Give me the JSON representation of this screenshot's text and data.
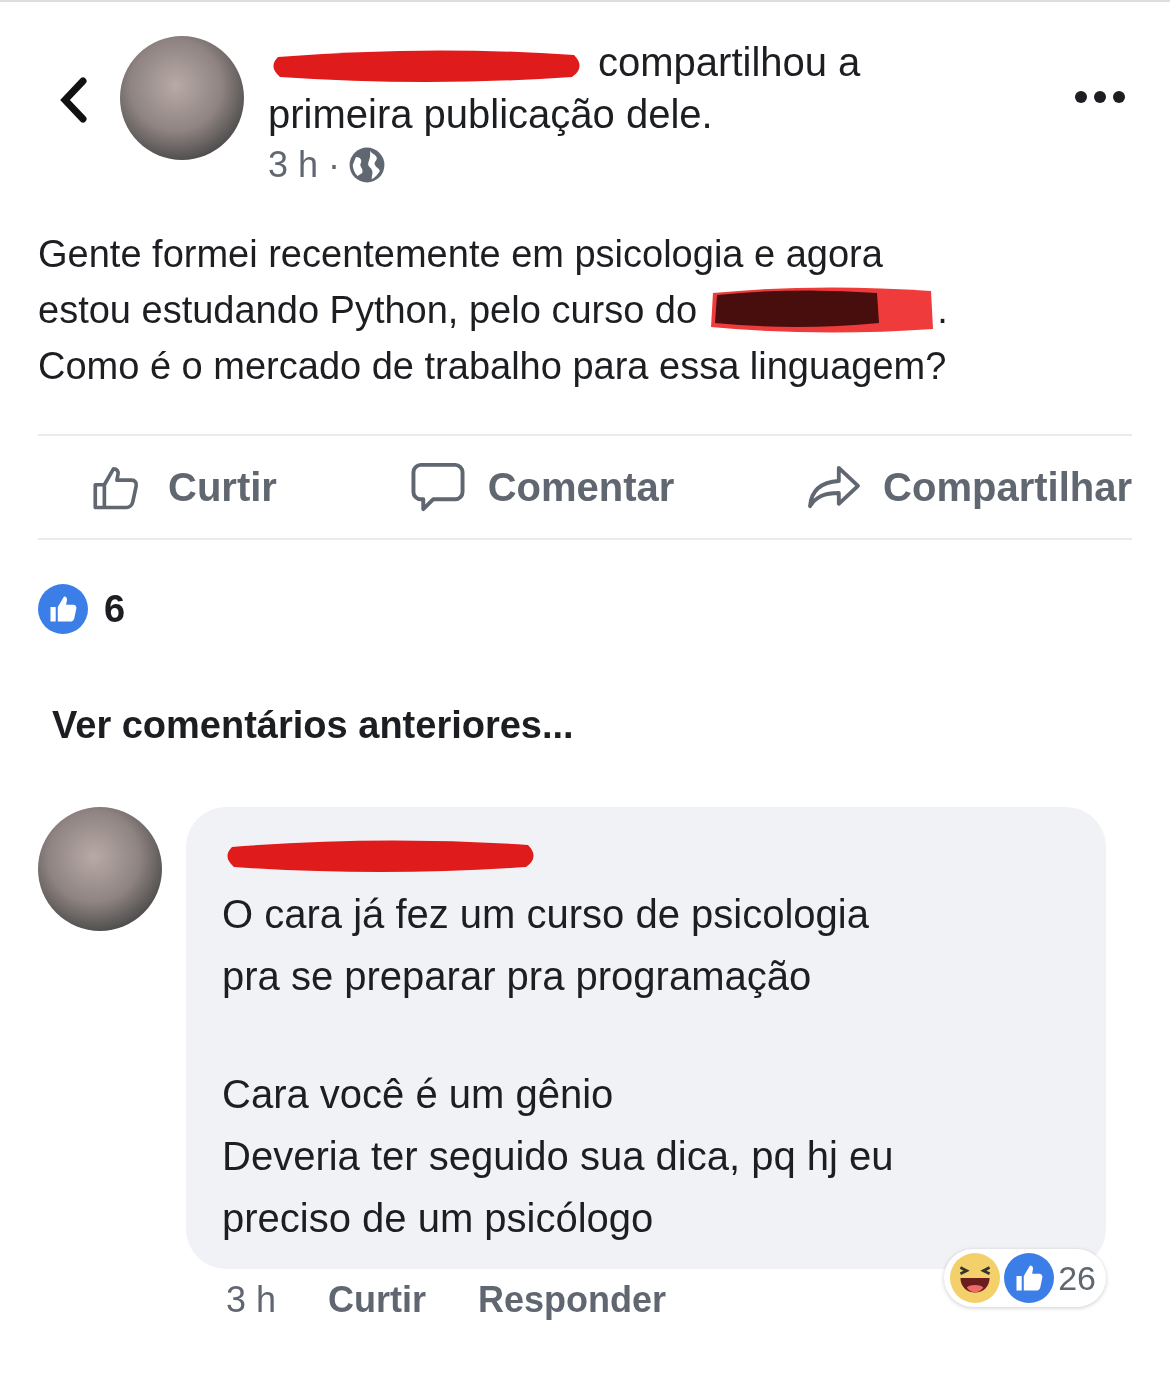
{
  "post": {
    "header_text": "compartilhou a primeira publicação dele.",
    "time": "3 h",
    "separator": "·",
    "body": [
      {
        "text": "Gente formei recentemente em psicologia e agora",
        "redacted": false
      },
      {
        "text": "estou estudando Python, pelo curso do",
        "redacted": true,
        "suffix": "."
      },
      {
        "text": "Como é o mercado de trabalho para essa linguagem?",
        "redacted": false
      }
    ],
    "actions": [
      {
        "kind": "like",
        "label": "Curtir"
      },
      {
        "kind": "comment",
        "label": "Comentar"
      },
      {
        "kind": "share",
        "label": "Compartilhar"
      }
    ],
    "reaction_count": "6"
  },
  "previous_comments_link": "Ver comentários anteriores...",
  "comment": {
    "paragraphs": [
      [
        "O cara já fez um curso de psicologia",
        "pra se preparar pra programação"
      ],
      [
        "Cara você é um gênio",
        "Deveria ter seguido sua dica, pq hj eu",
        "preciso de um psicólogo"
      ]
    ],
    "time": "3 h",
    "actions": [
      "Curtir",
      "Responder"
    ],
    "reaction_count": "26"
  }
}
